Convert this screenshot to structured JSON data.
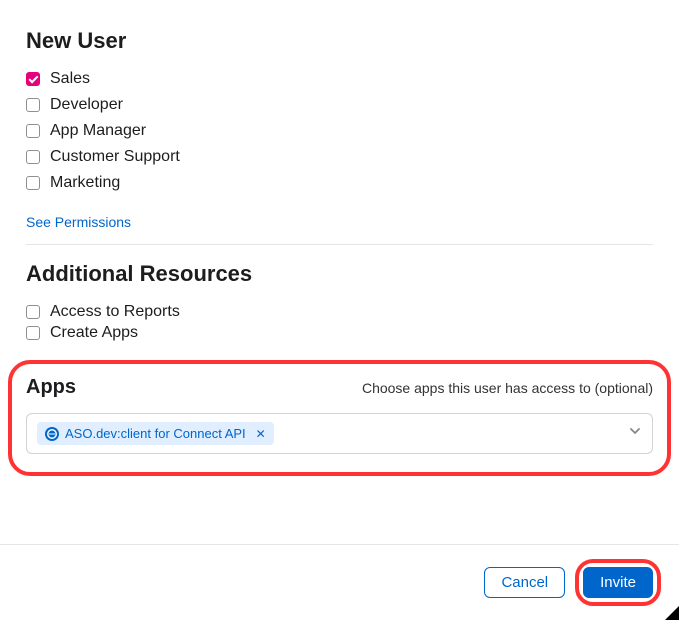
{
  "title": "New User",
  "roles": [
    {
      "label": "Sales",
      "checked": true
    },
    {
      "label": "Developer",
      "checked": false
    },
    {
      "label": "App Manager",
      "checked": false
    },
    {
      "label": "Customer Support",
      "checked": false
    },
    {
      "label": "Marketing",
      "checked": false
    }
  ],
  "permLink": "See Permissions",
  "resourcesTitle": "Additional Resources",
  "resources": [
    {
      "label": "Access to Reports",
      "checked": false
    },
    {
      "label": "Create Apps",
      "checked": false
    }
  ],
  "appsTitle": "Apps",
  "appsHint": "Choose apps this user has access to (optional)",
  "tagLabel": "ASO.dev:client for Connect API",
  "cancelLabel": "Cancel",
  "inviteLabel": "Invite"
}
